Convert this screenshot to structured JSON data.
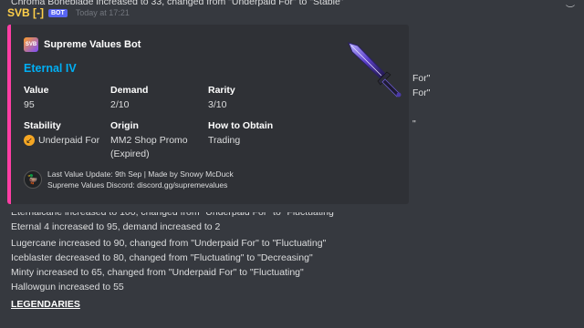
{
  "top_partial_line": "Chroma Boneblade increased to 33, changed from \"Underpaid For\" to \"Stable\"",
  "message": {
    "username": "SVB [-]",
    "bot_tag": "BOT",
    "timestamp": "Today at 17:21"
  },
  "embed": {
    "accent_color": "#ff3ea5",
    "author_icon_text": "SVB",
    "author": "Supreme Values Bot",
    "title": "Eternal IV",
    "fields": {
      "value": {
        "name": "Value",
        "value": "95"
      },
      "demand": {
        "name": "Demand",
        "value": "2/10"
      },
      "rarity": {
        "name": "Rarity",
        "value": "3/10"
      },
      "stability": {
        "name": "Stability",
        "value": "Underpaid For"
      },
      "origin": {
        "name": "Origin",
        "value_line1": "MM2 Shop Promo",
        "value_line2": "(Expired)"
      },
      "how_to_obtain": {
        "name": "How to Obtain",
        "value": "Trading"
      }
    },
    "thumbnail_icon": "knife-icon",
    "footer_line1": "Last Value Update: 9th Sep | Made by Snowy McDuck",
    "footer_line2": "Supreme Values Discord: discord.gg/supremevalues"
  },
  "right_fragments": [
    "For\"",
    "For\"",
    "\""
  ],
  "lines": [
    "Eternalcane increased to 100, changed from \"Underpaid For\" to \"Fluctuating\"",
    "Eternal 4 increased to 95, demand increased to 2",
    "Lugercane increased to 90, changed from \"Underpaid For\" to \"Fluctuating\"",
    "Iceblaster decreased to 80, changed from \"Fluctuating\" to \"Decreasing\"",
    "Minty increased to 65, changed from \"Underpaid For\" to \"Fluctuating\"",
    "Hallowgun increased to 55"
  ],
  "section_heading": "LEGENDARIES"
}
